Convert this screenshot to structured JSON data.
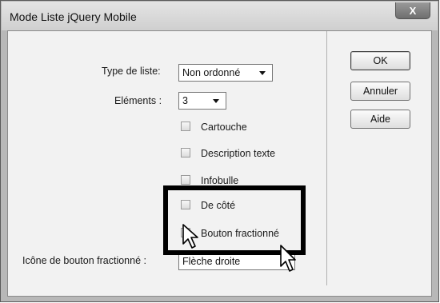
{
  "window": {
    "title": "Mode Liste jQuery Mobile",
    "close_label": "X"
  },
  "form": {
    "type_label": "Type de liste:",
    "type_value": "Non ordonné",
    "elements_label": "Eléments :",
    "elements_value": "3",
    "checkboxes": [
      {
        "label": "Cartouche",
        "checked": false
      },
      {
        "label": "Description texte",
        "checked": false
      },
      {
        "label": "Infobulle",
        "checked": false
      },
      {
        "label": "De côté",
        "checked": false
      },
      {
        "label": "Bouton fractionné",
        "checked": true
      }
    ],
    "split_icon_label": "Icône de bouton fractionné :",
    "split_icon_value": "Flèche droite"
  },
  "buttons": {
    "ok": "OK",
    "cancel": "Annuler",
    "help": "Aide"
  },
  "icons": [
    "close-icon",
    "dropdown-arrow-icon",
    "mouse-pointer-icon"
  ]
}
